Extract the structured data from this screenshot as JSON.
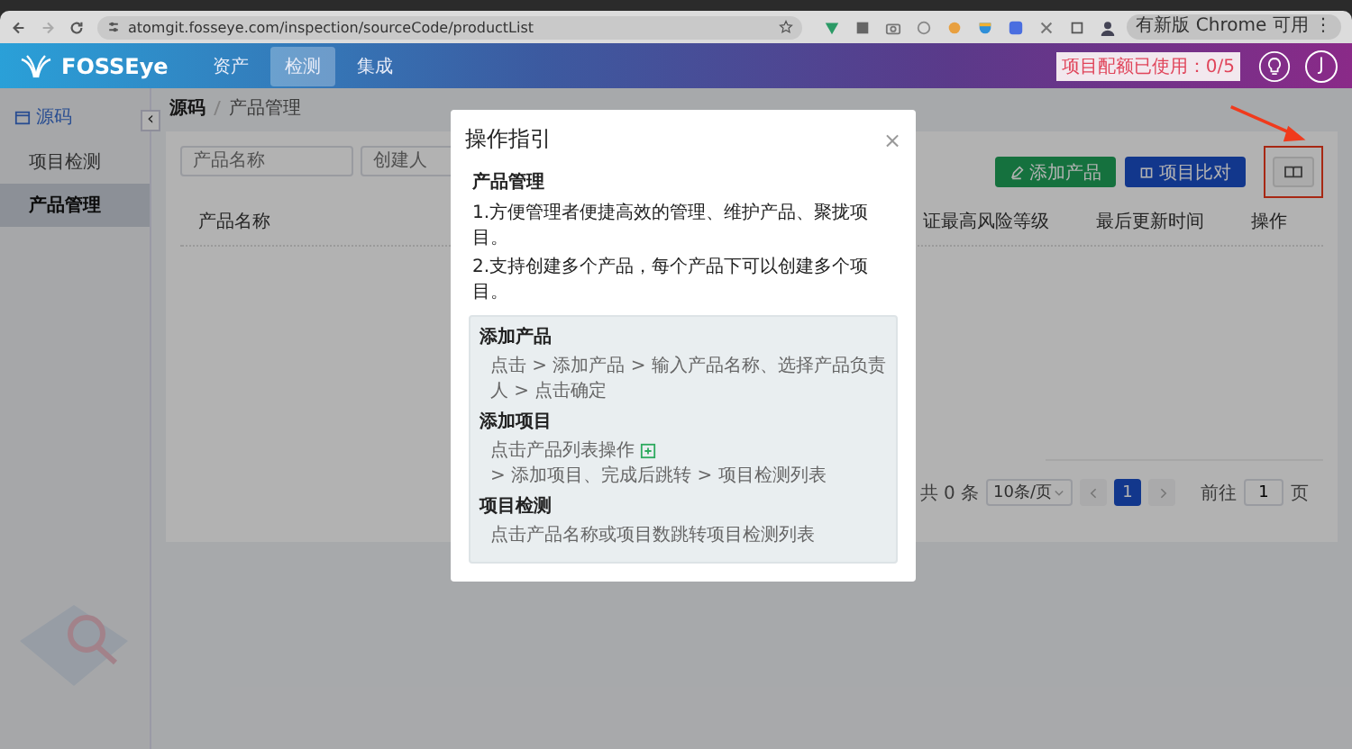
{
  "browser": {
    "url": "atomgit.fosseye.com/inspection/sourceCode/productList",
    "update_button": "有新版 Chrome 可用",
    "menu_glyph": "⋮"
  },
  "header": {
    "logo": "FOSSEye",
    "nav": [
      {
        "label": "资产",
        "selected": false
      },
      {
        "label": "检测",
        "selected": true
      },
      {
        "label": "集成",
        "selected": false
      }
    ],
    "quota": "项目配额已使用：0/5",
    "avatar": "J"
  },
  "sidebar": {
    "section": "源码",
    "collapse_glyph": "‹",
    "items": [
      {
        "label": "项目检测",
        "selected": false
      },
      {
        "label": "产品管理",
        "selected": true
      }
    ]
  },
  "breadcrumb": [
    "源码",
    "产品管理"
  ],
  "filters": [
    {
      "placeholder": "产品名称"
    },
    {
      "placeholder": "创建人"
    }
  ],
  "actions": [
    {
      "kind": "add",
      "label": "添加产品"
    },
    {
      "kind": "compare",
      "label": "项目比对"
    },
    {
      "kind": "guide"
    }
  ],
  "table": {
    "columns": [
      {
        "label": "产品名称"
      },
      {
        "label": "证最高风险等级"
      },
      {
        "label": "最后更新时间"
      },
      {
        "label": "操作"
      }
    ]
  },
  "pagination": {
    "total": "共 0 条",
    "page_size": "10条/页",
    "pages": [
      {
        "label": "1",
        "selected": true
      }
    ],
    "goto_label": "前往",
    "goto_value": "1",
    "page_unit": "页"
  },
  "dialog": {
    "title": "操作指引",
    "close": "×",
    "section": "产品管理",
    "lines": [
      "1.方便管理者便捷高效的管理、维护产品、聚拢项目。",
      "2.支持创建多个产品，每个产品下可以创建多个项目。"
    ],
    "steps": [
      {
        "title": "添加产品",
        "text": "点击 > 添加产品 > 输入产品名称、选择产品负责人 > 点击确定"
      },
      {
        "title": "添加项目",
        "text": "点击产品列表操作",
        "text_after_icon": "> 添加项目、完成后跳转 > 项目检测列表"
      },
      {
        "title": "项目检测",
        "text": "点击产品名称或项目数跳转项目检测列表"
      }
    ]
  }
}
